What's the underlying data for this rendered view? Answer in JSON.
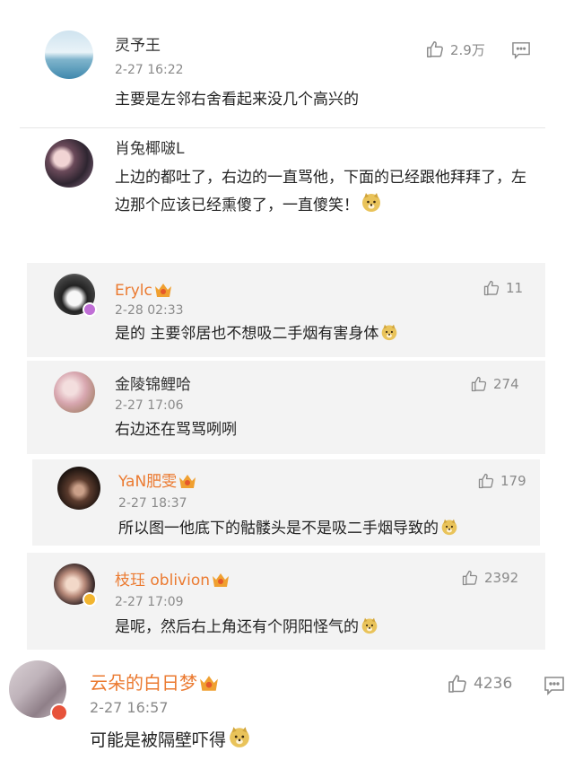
{
  "comments": [
    {
      "user": "灵予王",
      "time": "2-27 16:22",
      "likes": "2.9万",
      "text": "主要是左邻右舍看起来没几个高兴的"
    },
    {
      "user": "肖兔椰啵L",
      "text": "上边的都吐了，右边的一直骂他，下面的已经跟他拜拜了，左边那个应该已经熏傻了，一直傻笑！"
    },
    {
      "user": "Erylc",
      "time": "2-28 02:33",
      "likes": "11",
      "text": "是的 主要邻居也不想吸二手烟有害身体"
    },
    {
      "user": "金陵锦鲤哈",
      "time": "2-27 17:06",
      "likes": "274",
      "text": "右边还在骂骂咧咧"
    },
    {
      "user": "YaN肥雯",
      "time": "2-27 18:37",
      "likes": "179",
      "text": "所以图一他底下的骷髅头是不是吸二手烟导致的"
    },
    {
      "user": "枝珏 oblivion",
      "time": "2-27 17:09",
      "likes": "2392",
      "text": "是呢，然后右上角还有个阴阳怪气的"
    },
    {
      "user": "云朵的白日梦",
      "time": "2-27 16:57",
      "likes": "4236",
      "text": "可能是被隔壁吓得"
    }
  ],
  "icons": {
    "like": "thumb-up-icon",
    "reply": "comment-icon",
    "emoji": "doge-emoji",
    "crown": "vip-crown-icon",
    "verified": "verified-badge"
  },
  "colors": {
    "username_vip": "#eb7a30",
    "username": "#333333",
    "meta": "#8a8a8a",
    "card_gray": "#f3f3f3"
  }
}
